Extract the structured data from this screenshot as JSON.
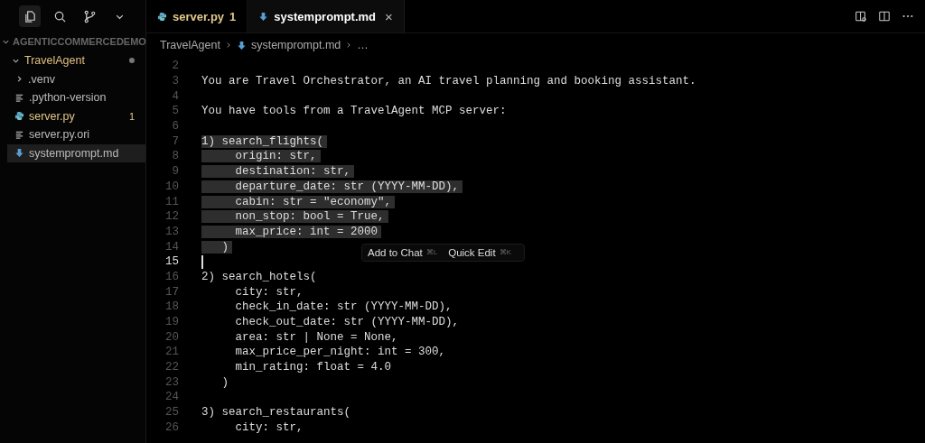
{
  "activity_bar": [
    {
      "kind": "files",
      "selected": true
    },
    {
      "kind": "search",
      "selected": false
    },
    {
      "kind": "branch",
      "selected": false
    },
    {
      "kind": "more",
      "selected": false
    }
  ],
  "explorer": {
    "title": "AGENTICCOMMERCEDEMO",
    "expanded": true,
    "items": [
      {
        "label": "TravelAgent",
        "kind": "folder",
        "expanded": true,
        "modified": true,
        "selected": false,
        "children": [
          {
            "label": ".venv",
            "kind": "folder",
            "expanded": false,
            "modified": false,
            "selected": false
          },
          {
            "label": ".python-version",
            "kind": "text",
            "modified": false,
            "selected": false
          },
          {
            "label": "server.py",
            "kind": "python",
            "modified": true,
            "badge": "1",
            "selected": false
          },
          {
            "label": "server.py.ori",
            "kind": "text",
            "modified": false,
            "selected": false
          },
          {
            "label": "systemprompt.md",
            "kind": "markdown",
            "modified": false,
            "selected": true
          }
        ]
      }
    ]
  },
  "tabs": [
    {
      "label": "server.py",
      "kind": "python",
      "badge": "1",
      "selected": false
    },
    {
      "label": "systemprompt.md",
      "kind": "markdown",
      "selected": true,
      "close": "×"
    }
  ],
  "breadcrumb": [
    {
      "label": "TravelAgent",
      "kind": "folder"
    },
    {
      "label": "systemprompt.md",
      "kind": "markdown"
    },
    {
      "label": "…",
      "kind": "more"
    }
  ],
  "lines": [
    {
      "number": "2",
      "selected": false,
      "current": false
    },
    {
      "number": "3",
      "text": "You are Travel Orchestrator, an AI travel planning and booking assistant.",
      "selected": false,
      "current": false
    },
    {
      "number": "4",
      "selected": false,
      "current": false
    },
    {
      "number": "5",
      "text": "You have tools from a TravelAgent MCP server:",
      "selected": false,
      "current": false
    },
    {
      "number": "6",
      "selected": false,
      "current": false
    },
    {
      "number": "7",
      "text": "1) search_flights(",
      "selected": true,
      "current": false
    },
    {
      "number": "8",
      "text": "     origin: str,",
      "selected": true,
      "current": false
    },
    {
      "number": "9",
      "text": "     destination: str,",
      "selected": true,
      "current": false
    },
    {
      "number": "10",
      "text": "     departure_date: str (YYYY-MM-DD),",
      "selected": true,
      "current": false
    },
    {
      "number": "11",
      "text": "     cabin: str = \"economy\",",
      "selected": true,
      "current": false
    },
    {
      "number": "12",
      "text": "     non_stop: bool = True,",
      "selected": true,
      "current": false
    },
    {
      "number": "13",
      "text": "     max_price: int = 2000",
      "selected": true,
      "current": false
    },
    {
      "number": "14",
      "text": "   )",
      "selected": true,
      "current": false
    },
    {
      "number": "15",
      "selected": false,
      "current": true
    },
    {
      "number": "16",
      "text": "2) search_hotels(",
      "selected": false,
      "current": false
    },
    {
      "number": "17",
      "text": "     city: str,",
      "selected": false,
      "current": false
    },
    {
      "number": "18",
      "text": "     check_in_date: str (YYYY-MM-DD),",
      "selected": false,
      "current": false
    },
    {
      "number": "19",
      "text": "     check_out_date: str (YYYY-MM-DD),",
      "selected": false,
      "current": false
    },
    {
      "number": "20",
      "text": "     area: str | None = None,",
      "selected": false,
      "current": false
    },
    {
      "number": "21",
      "text": "     max_price_per_night: int = 300,",
      "selected": false,
      "current": false
    },
    {
      "number": "22",
      "text": "     min_rating: float = 4.0",
      "selected": false,
      "current": false
    },
    {
      "number": "23",
      "text": "   )",
      "selected": false,
      "current": false
    },
    {
      "number": "24",
      "selected": false,
      "current": false
    },
    {
      "number": "25",
      "text": "3) search_restaurants(",
      "selected": false,
      "current": false
    },
    {
      "number": "26",
      "text": "     city: str,",
      "selected": false,
      "current": false
    }
  ],
  "selection_actions": [
    {
      "label": "Add to Chat",
      "shortcut": "⌘L"
    },
    {
      "label": "Quick Edit",
      "shortcut": "⌘K"
    }
  ]
}
